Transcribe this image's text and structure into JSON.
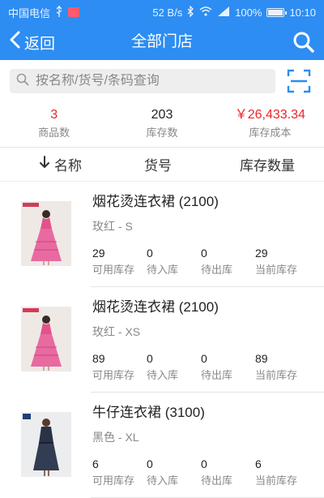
{
  "status_bar": {
    "carrier": "中国电信",
    "speed": "52 B/s",
    "battery": "100%",
    "time": "10:10"
  },
  "header": {
    "back_label": "返回",
    "title": "全部门店"
  },
  "search": {
    "placeholder": "按名称/货号/条码查询"
  },
  "summary": {
    "product_count": {
      "value": "3",
      "label": "商品数"
    },
    "stock_count": {
      "value": "203",
      "label": "库存数"
    },
    "stock_cost": {
      "value": "￥26,433.34",
      "label": "库存成本"
    }
  },
  "columns": {
    "name": "名称",
    "code": "货号",
    "quantity": "库存数量"
  },
  "stock_labels": {
    "available": "可用库存",
    "incoming": "待入库",
    "outgoing": "待出库",
    "current": "当前库存"
  },
  "products": [
    {
      "name": "烟花烫连衣裙 (2100)",
      "variant": "玫红 - S",
      "available": "29",
      "incoming": "0",
      "outgoing": "0",
      "current": "29"
    },
    {
      "name": "烟花烫连衣裙 (2100)",
      "variant": "玫红 - XS",
      "available": "89",
      "incoming": "0",
      "outgoing": "0",
      "current": "89"
    },
    {
      "name": "牛仔连衣裙 (3100)",
      "variant": "黑色 - XL",
      "available": "6",
      "incoming": "0",
      "outgoing": "0",
      "current": "6"
    }
  ],
  "colors": {
    "brand_blue": "#2d8df2",
    "accent_red": "#e8262a"
  }
}
